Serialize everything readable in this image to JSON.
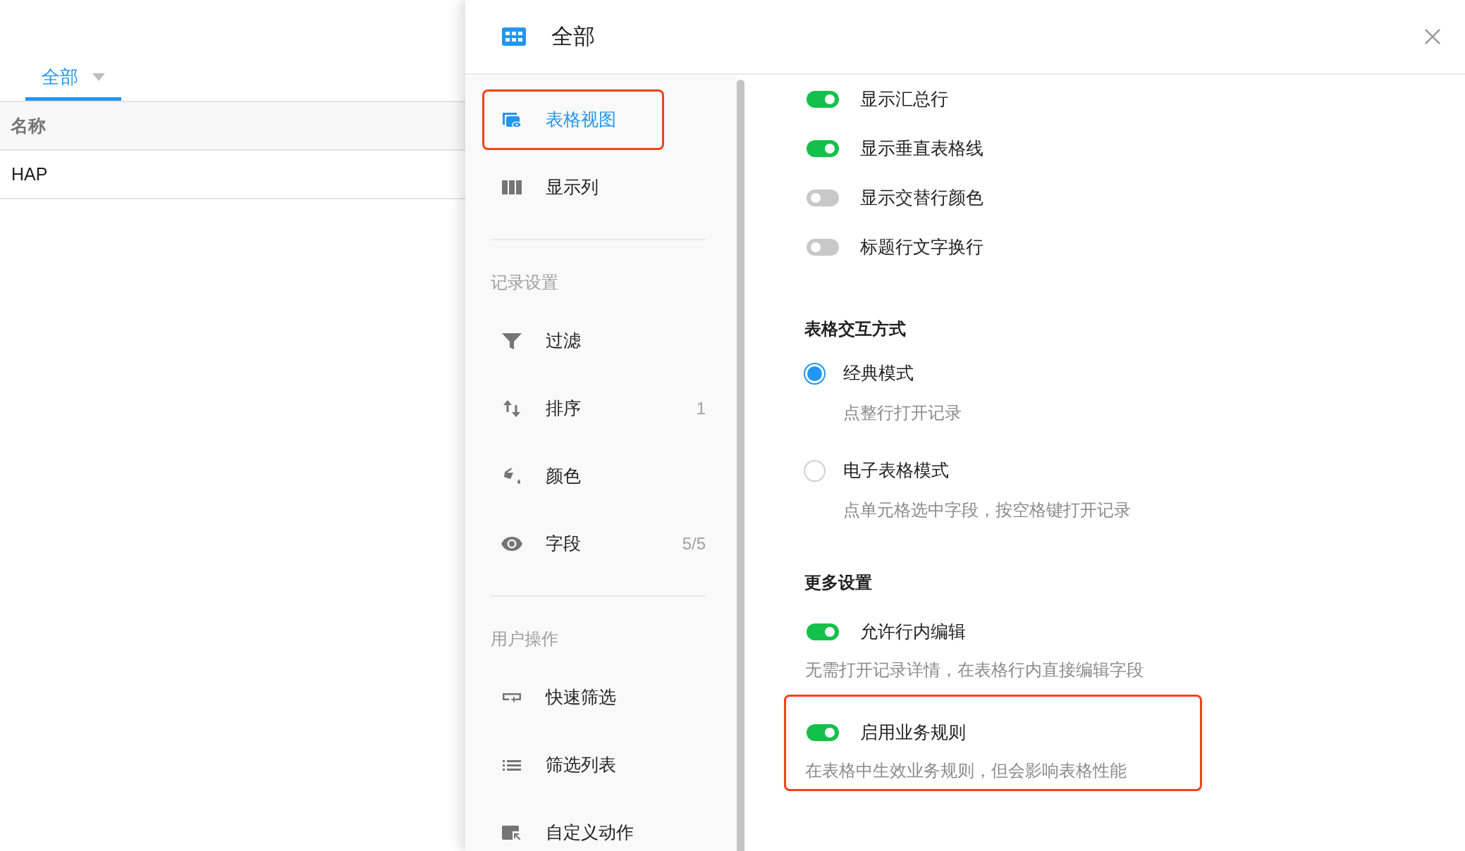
{
  "left_view": {
    "tab": {
      "label": "全部",
      "selected": true
    },
    "table": {
      "columns": [
        "名称"
      ],
      "rows": [
        [
          "HAP"
        ]
      ]
    }
  },
  "panel": {
    "title": "全部",
    "sidebar": [
      {
        "kind": "item",
        "label": "表格视图",
        "selected": true,
        "highlighted": true
      },
      {
        "kind": "item",
        "label": "显示列",
        "selected": false,
        "highlighted": false
      },
      {
        "kind": "divider"
      },
      {
        "kind": "heading",
        "label": "记录设置"
      },
      {
        "kind": "item",
        "label": "过滤",
        "selected": false,
        "highlighted": false
      },
      {
        "kind": "item",
        "label": "排序",
        "count": "1",
        "selected": false,
        "highlighted": false
      },
      {
        "kind": "item",
        "label": "颜色",
        "selected": false,
        "highlighted": false
      },
      {
        "kind": "item",
        "label": "字段",
        "count": "5/5",
        "selected": false,
        "highlighted": false
      },
      {
        "kind": "divider"
      },
      {
        "kind": "heading",
        "label": "用户操作"
      },
      {
        "kind": "item",
        "label": "快速筛选",
        "selected": false,
        "highlighted": false
      },
      {
        "kind": "item",
        "label": "筛选列表",
        "selected": false,
        "highlighted": false
      },
      {
        "kind": "item",
        "label": "自定义动作",
        "selected": false,
        "highlighted": false
      }
    ],
    "toggles": [
      {
        "label": "显示汇总行",
        "on": true
      },
      {
        "label": "显示垂直表格线",
        "on": true
      },
      {
        "label": "显示交替行颜色",
        "on": false
      },
      {
        "label": "标题行文字换行",
        "on": false
      }
    ],
    "interaction": {
      "title": "表格交互方式",
      "options": [
        {
          "label": "经典模式",
          "description": "点整行打开记录",
          "selected": true
        },
        {
          "label": "电子表格模式",
          "description": "点单元格选中字段，按空格键打开记录",
          "selected": false
        }
      ]
    },
    "more": {
      "title": "更多设置",
      "items": [
        {
          "label": "允许行内编辑",
          "on": true,
          "description": "无需打开记录详情，在表格行内直接编辑字段",
          "highlighted": false
        },
        {
          "label": "启用业务规则",
          "on": true,
          "description": "在表格中生效业务规则，但会影响表格性能",
          "highlighted": true
        }
      ]
    }
  }
}
